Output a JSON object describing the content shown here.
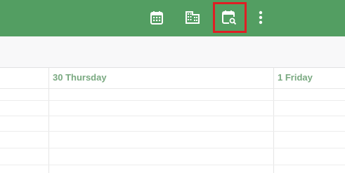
{
  "toolbar": {
    "background_color": "#539e62",
    "icons": [
      {
        "name": "calendar-icon"
      },
      {
        "name": "building-icon"
      },
      {
        "name": "calendar-search-icon"
      },
      {
        "name": "more-vertical-icon"
      }
    ],
    "highlight_color": "#e01e24"
  },
  "calendar": {
    "days": [
      {
        "label": "30 Thursday"
      },
      {
        "label": "1 Friday"
      }
    ],
    "day_label_color": "#79a980"
  }
}
